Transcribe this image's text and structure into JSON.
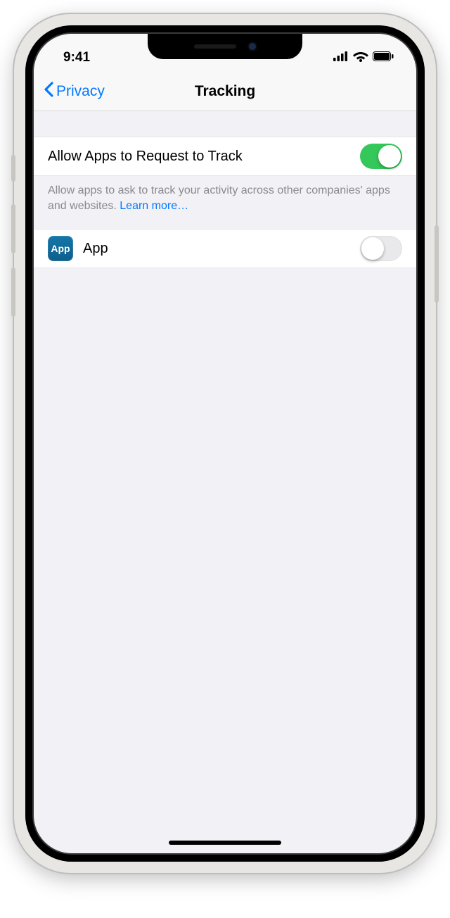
{
  "status": {
    "time": "9:41"
  },
  "nav": {
    "back_label": "Privacy",
    "title": "Tracking"
  },
  "main_toggle": {
    "label": "Allow Apps to Request to Track",
    "on": true
  },
  "footer": {
    "text": "Allow apps to ask to track your activity across other companies' apps and websites. ",
    "link": "Learn more…"
  },
  "app_row": {
    "icon_label": "App",
    "name": "App",
    "on": false
  }
}
